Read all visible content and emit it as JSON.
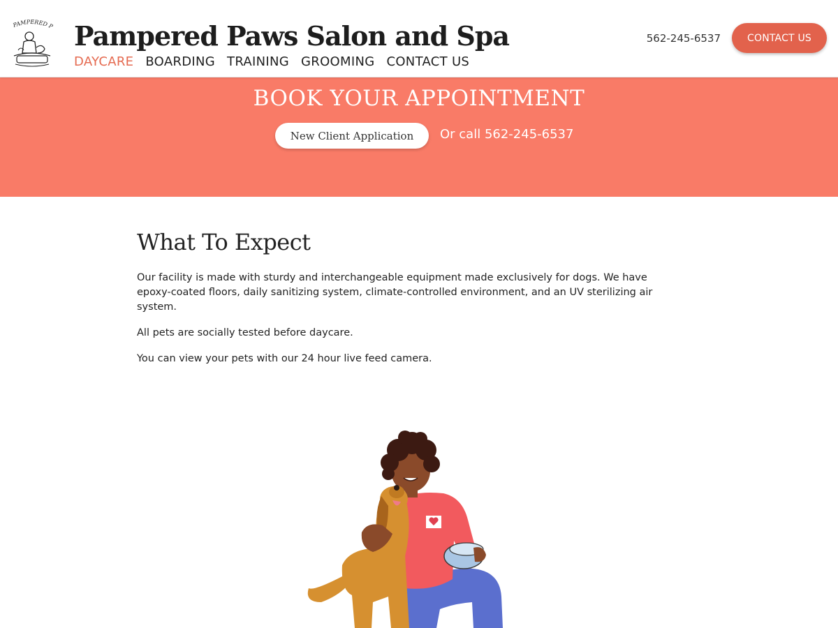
{
  "header": {
    "logo_text": "PAMPERED PAWS",
    "site_title": "Pampered Paws Salon and Spa",
    "nav": [
      {
        "label": "DAYCARE",
        "active": true
      },
      {
        "label": "BOARDING",
        "active": false
      },
      {
        "label": "TRAINING",
        "active": false
      },
      {
        "label": "GROOMING",
        "active": false
      },
      {
        "label": "CONTACT US",
        "active": false
      }
    ],
    "phone": "562-245-6537",
    "contact_button": "CONTACT US"
  },
  "banner": {
    "title": "BOOK YOUR APPOINTMENT",
    "client_button": "New Client Application",
    "call_text": "Or call 562-245-6537"
  },
  "main": {
    "section_title": "What To Expect",
    "paragraphs": [
      "Our facility is made with sturdy and interchangeable equipment made exclusively for dogs. We have epoxy-coated floors, daily sanitizing system, climate-controlled environment, and an UV sterilizing air system.",
      "All pets are socially tested before daycare.",
      "You can view your pets with our 24 hour live feed camera."
    ]
  },
  "colors": {
    "accent": "#e2624c",
    "banner_bg": "#f97b67",
    "nav_active": "#e56a50"
  },
  "icons": {
    "logo": "salon-logo-icon",
    "illustration": "person-with-dog-illustration"
  }
}
